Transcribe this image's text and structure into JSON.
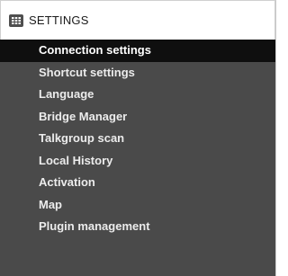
{
  "header": {
    "title": "SETTINGS",
    "icon": "settings-grid-icon"
  },
  "menu": {
    "selected_index": 0,
    "items": [
      {
        "label": "Connection settings"
      },
      {
        "label": "Shortcut settings"
      },
      {
        "label": "Language"
      },
      {
        "label": "Bridge Manager"
      },
      {
        "label": "Talkgroup scan"
      },
      {
        "label": "Local History"
      },
      {
        "label": "Activation"
      },
      {
        "label": "Map"
      },
      {
        "label": "Plugin management"
      }
    ]
  },
  "colors": {
    "panel_background": "#4a4a4a",
    "selected_background": "#0f0f0f",
    "item_text": "#ececec",
    "header_background": "#ffffff"
  }
}
